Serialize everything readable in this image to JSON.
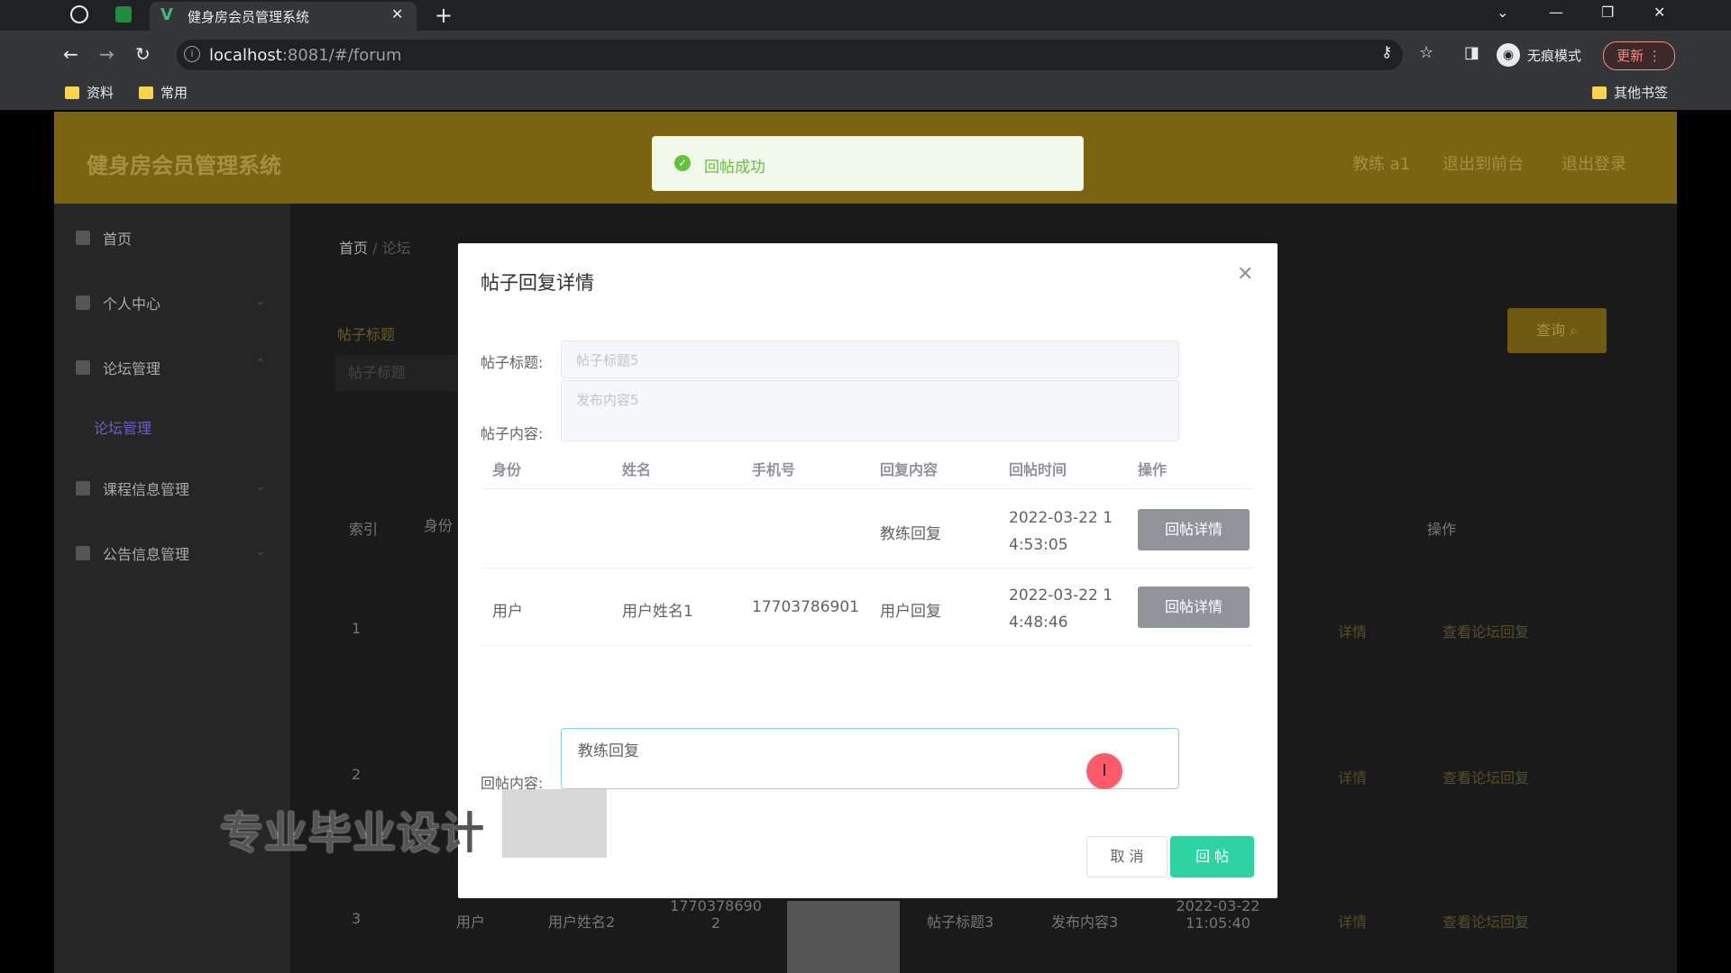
{
  "browser": {
    "tab_title": "健身房会员管理系统",
    "url_host": "localhost",
    "url_rest": ":8081/#/forum",
    "bookmarks": [
      "资料",
      "常用"
    ],
    "other_bookmarks": "其他书签",
    "incognito_label": "无痕模式",
    "update_label": "更新"
  },
  "header": {
    "system_title": "健身房会员管理系统",
    "user_label": "教练 a1",
    "back_label": "退出到前台",
    "logout_label": "退出登录"
  },
  "sidebar": {
    "items": [
      {
        "label": "首页"
      },
      {
        "label": "个人中心"
      },
      {
        "label": "论坛管理"
      },
      {
        "label": "论坛管理"
      },
      {
        "label": "课程信息管理"
      },
      {
        "label": "公告信息管理"
      }
    ]
  },
  "breadcrumb": {
    "home": "首页",
    "sep": "/",
    "current": "论坛"
  },
  "background": {
    "filter_label": "帖子标题",
    "filter_placeholder": "帖子标题",
    "query_button": "查询",
    "col_index": "索引",
    "col_identity": "身份",
    "col_ops": "操作",
    "row_index": [
      "1",
      "2",
      "3"
    ],
    "row3": {
      "identity": "用户",
      "name": "用户姓名2",
      "phone": "1770378690 2",
      "title": "帖子标题3",
      "content": "发布内容3",
      "time": "2022-03-22 11:05:40"
    },
    "op_detail": "详情",
    "op_view": "查看论坛回复"
  },
  "toast": {
    "message": "回帖成功"
  },
  "dialog": {
    "title": "帖子回复详情",
    "post_title_label": "帖子标题:",
    "post_title_value": "帖子标题5",
    "post_content_label": "帖子内容:",
    "post_content_value": "发布内容5",
    "columns": [
      "身份",
      "姓名",
      "手机号",
      "回复内容",
      "回帖时间",
      "操作"
    ],
    "rows": [
      {
        "identity": "",
        "name": "",
        "phone": "",
        "content": "教练回复",
        "time": "2022-03-22 14:53:05",
        "action": "回帖详情"
      },
      {
        "identity": "用户",
        "name": "用户姓名1",
        "phone": "17703786901",
        "content": "用户回复",
        "time": "2022-03-22 14:48:46",
        "action": "回帖详情"
      }
    ],
    "reply_label": "回帖内容:",
    "reply_value": "教练回复",
    "cancel_label": "取 消",
    "submit_label": "回 帖"
  },
  "overlay": {
    "watermark": "专业毕业设计"
  }
}
